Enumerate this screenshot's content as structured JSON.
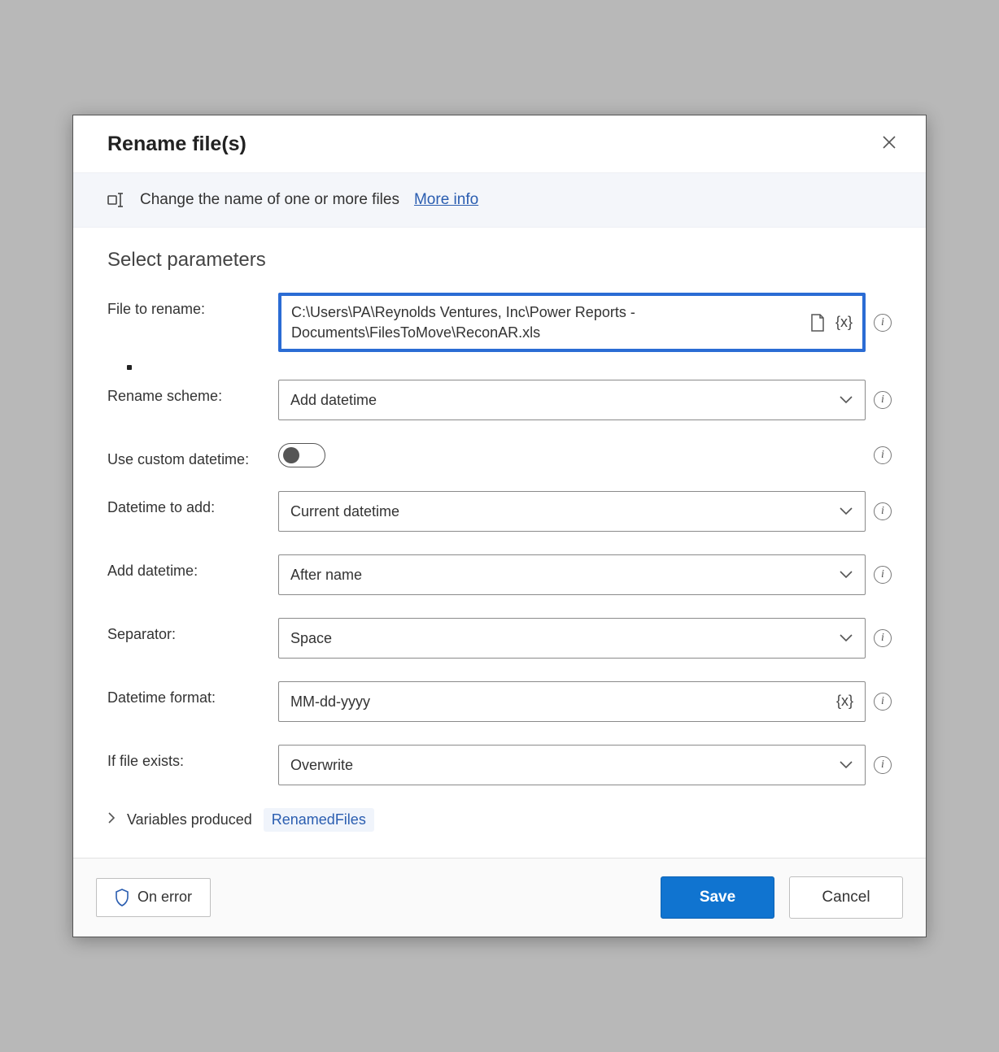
{
  "title": "Rename file(s)",
  "description": {
    "text": "Change the name of one or more files",
    "more_link": "More info"
  },
  "section_title": "Select parameters",
  "fields": {
    "file_to_rename": {
      "label": "File to rename:",
      "value": "C:\\Users\\PA\\Reynolds Ventures, Inc\\Power Reports - Documents\\FilesToMove\\ReconAR.xls"
    },
    "rename_scheme": {
      "label": "Rename scheme:",
      "value": "Add datetime"
    },
    "use_custom_datetime": {
      "label": "Use custom datetime:",
      "value": false
    },
    "datetime_to_add": {
      "label": "Datetime to add:",
      "value": "Current datetime"
    },
    "add_datetime": {
      "label": "Add datetime:",
      "value": "After name"
    },
    "separator": {
      "label": "Separator:",
      "value": "Space"
    },
    "datetime_format": {
      "label": "Datetime format:",
      "value": "MM-dd-yyyy"
    },
    "if_file_exists": {
      "label": "If file exists:",
      "value": "Overwrite"
    }
  },
  "variables": {
    "label": "Variables produced",
    "items": [
      "RenamedFiles"
    ]
  },
  "footer": {
    "on_error": "On error",
    "save": "Save",
    "cancel": "Cancel"
  },
  "glyphs": {
    "var_token": "{x}",
    "info": "i"
  }
}
